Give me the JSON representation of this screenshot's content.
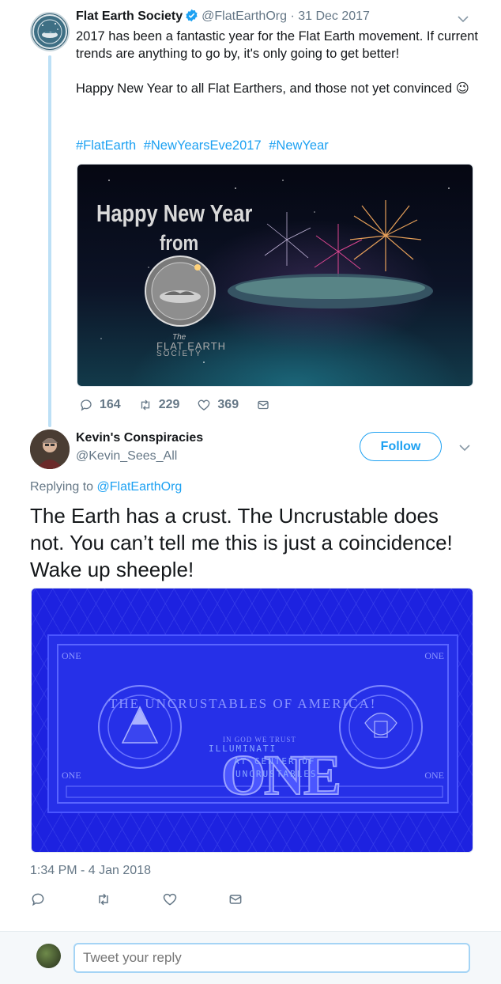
{
  "tweet1": {
    "author_name": "Flat Earth Society",
    "handle": "@FlatEarthOrg",
    "separator": "·",
    "date": "31 Dec 2017",
    "text_line1": "2017 has been a fantastic year for the Flat Earth movement. If current trends are anything to go by, it's only going to get better!",
    "text_line2": "Happy New Year to all Flat Earthers, and those not yet convinced",
    "emoji": "😉",
    "hashtags": [
      "#FlatEarth",
      "#NewYearsEve2017",
      "#NewYear"
    ],
    "image": {
      "headline": "Happy New Year",
      "subline": "from",
      "logo_the": "The",
      "logo_name": "FLAT EARTH",
      "logo_society": "SOCIETY"
    },
    "replies": "164",
    "retweets": "229",
    "likes": "369"
  },
  "tweet2": {
    "author_name": "Kevin's Conspiracies",
    "handle": "@Kevin_Sees_All",
    "follow_label": "Follow",
    "replying_prefix": "Replying to",
    "replying_to": "@FlatEarthOrg",
    "text": "The Earth has a crust. The Uncrustable does not. You can’t tell me this is just a coincidence! Wake up sheeple!",
    "image": {
      "banner": "THE UNCRUSTABLES OF AMERICA!",
      "motto": "IN GOD WE TRUST",
      "denomination": "ONE",
      "corner": "ONE",
      "scrawl_1": "ILLUMINATI",
      "scrawl_2": "AT CENTER OF",
      "scrawl_3": "UNCRUSTABLES"
    },
    "timestamp": "1:34 PM - 4 Jan 2018"
  },
  "reply_box": {
    "placeholder": "Tweet your reply"
  },
  "colors": {
    "accent": "#1da1f2",
    "muted": "#657786",
    "text": "#14171a",
    "thread_line": "#bde0f6"
  }
}
